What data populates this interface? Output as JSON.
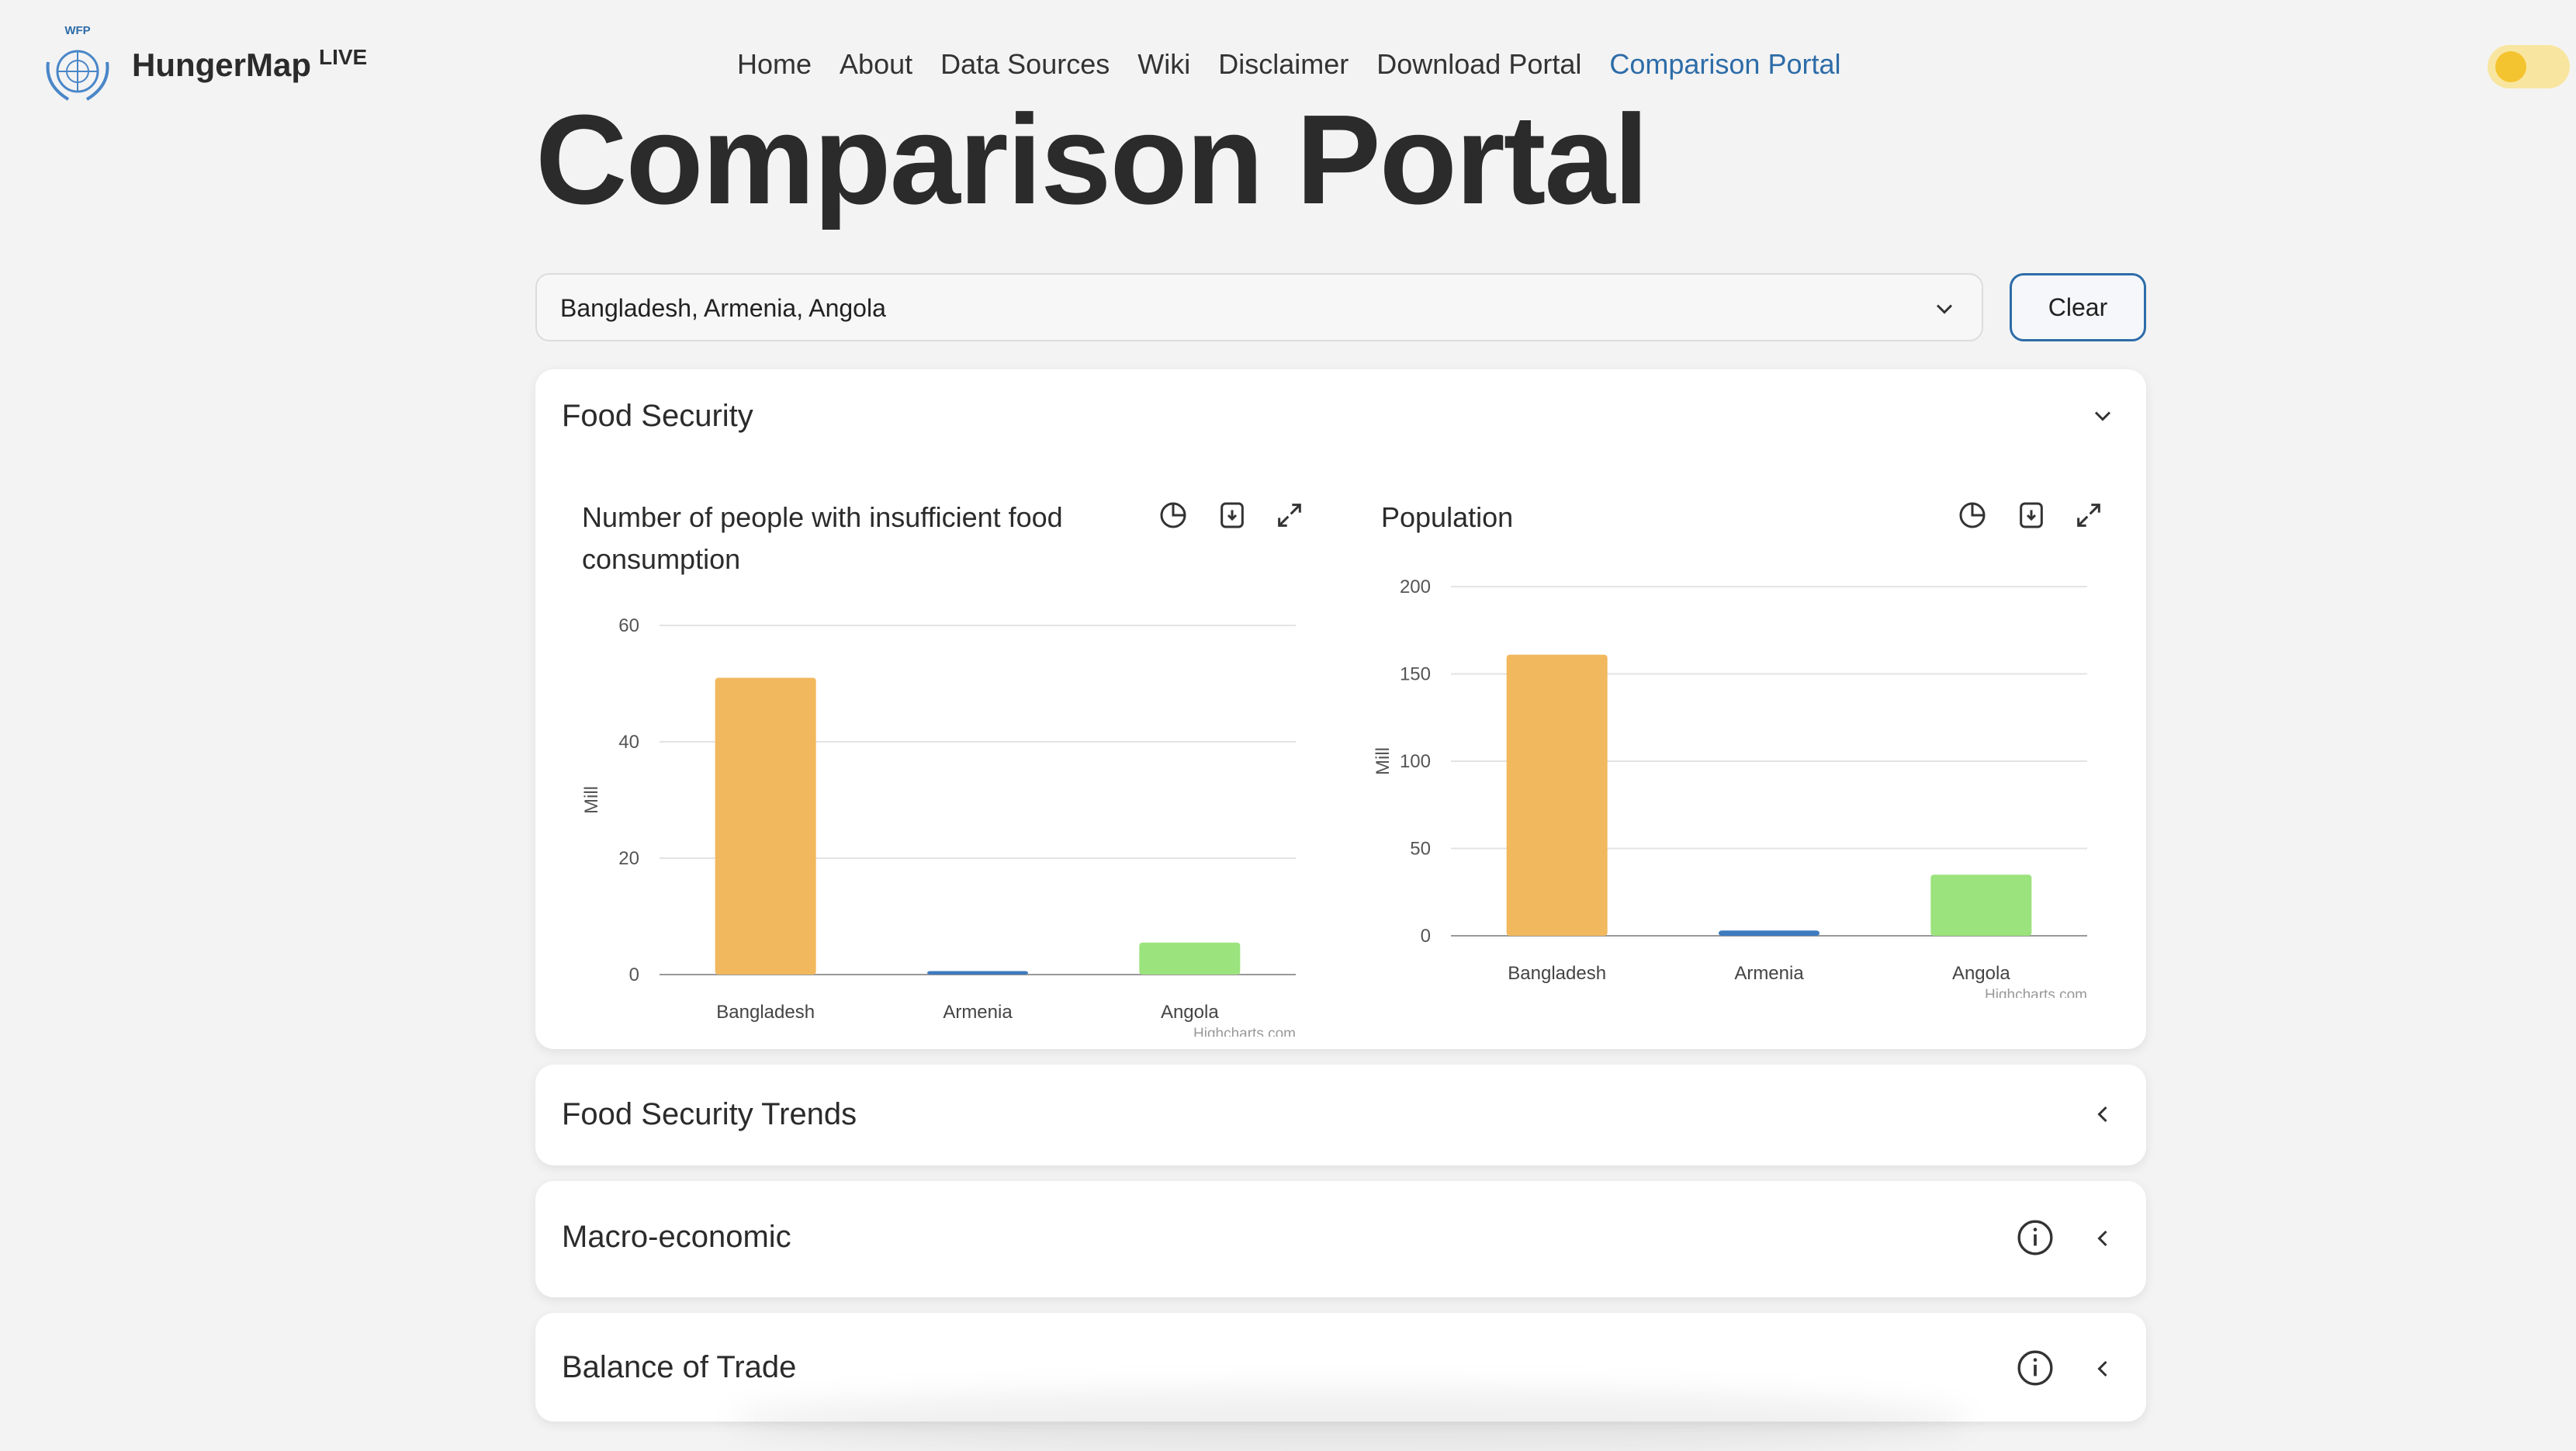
{
  "header": {
    "logo_top": "WFP",
    "logo_name": "HungerMap",
    "logo_sup": "LIVE",
    "nav": [
      {
        "label": "Home"
      },
      {
        "label": "About"
      },
      {
        "label": "Data Sources"
      },
      {
        "label": "Wiki"
      },
      {
        "label": "Disclaimer"
      },
      {
        "label": "Download Portal"
      },
      {
        "label": "Comparison Portal",
        "active": true
      }
    ]
  },
  "page": {
    "title": "Comparison Portal",
    "selector_value": "Bangladesh, Armenia, Angola",
    "clear_label": "Clear"
  },
  "sections": [
    {
      "title": "Food Security",
      "expanded": true
    },
    {
      "title": "Food Security Trends",
      "expanded": false
    },
    {
      "title": "Macro-economic",
      "expanded": false,
      "info": true
    },
    {
      "title": "Balance of Trade",
      "expanded": false,
      "info": true
    }
  ],
  "colors": {
    "Bangladesh": "#f2b85e",
    "Armenia": "#3f7bbf",
    "Angola": "#9be37d",
    "accent": "#2d6ca8"
  },
  "credit": "Highcharts.com",
  "chart_data": [
    {
      "type": "bar",
      "title": "Number of people with insufficient food consumption",
      "categories": [
        "Bangladesh",
        "Armenia",
        "Angola"
      ],
      "values": [
        51,
        0.6,
        5.5
      ],
      "ylabel": "Mill",
      "ylim": [
        0,
        60
      ],
      "yticks": [
        0,
        20,
        40,
        60
      ],
      "grid": true
    },
    {
      "type": "bar",
      "title": "Population",
      "categories": [
        "Bangladesh",
        "Armenia",
        "Angola"
      ],
      "values": [
        161,
        3,
        35
      ],
      "ylabel": "Mill",
      "ylim": [
        0,
        200
      ],
      "yticks": [
        0,
        50,
        100,
        150,
        200
      ],
      "grid": true
    }
  ]
}
